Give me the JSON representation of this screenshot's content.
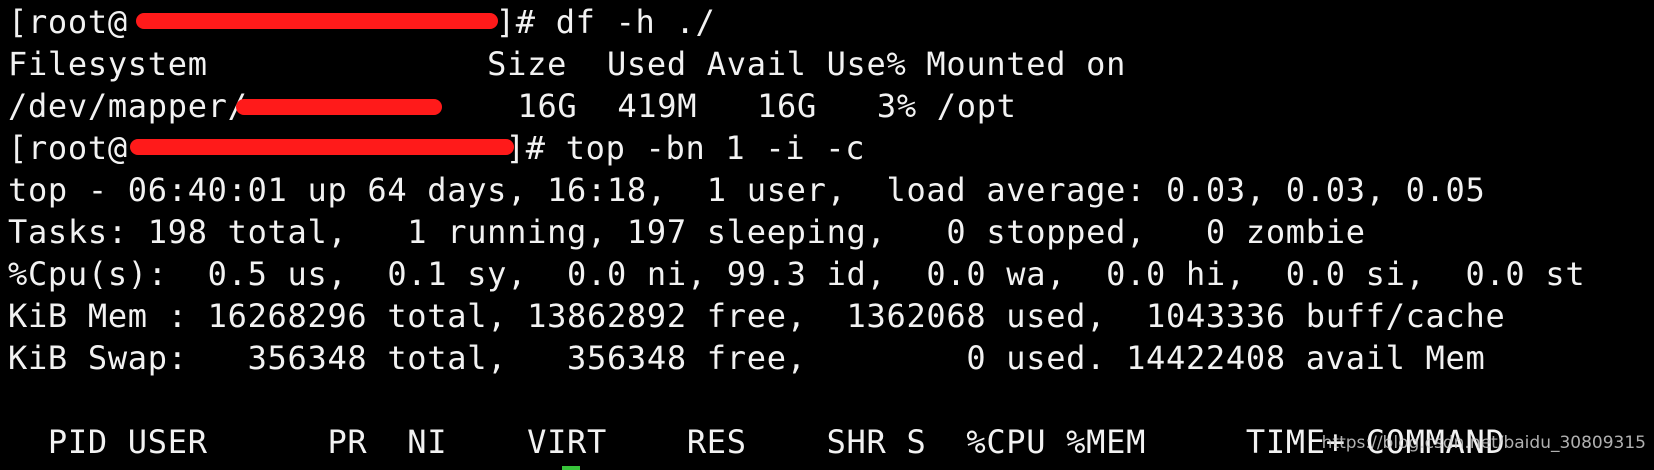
{
  "terminal": {
    "lines": {
      "l0_pre": "[root@",
      "l0_post": "]# df -h ./",
      "l1": "Filesystem              Size  Used Avail Use% Mounted on",
      "l2_pre": "/dev/mapper/",
      "l2_post": "   16G  419M   16G   3% /opt",
      "l3_pre": "[root@",
      "l3_post": "]# top -bn 1 -i -c",
      "l4": "top - 06:40:01 up 64 days, 16:18,  1 user,  load average: 0.03, 0.03, 0.05",
      "l5": "Tasks: 198 total,   1 running, 197 sleeping,   0 stopped,   0 zombie",
      "l6": "%Cpu(s):  0.5 us,  0.1 sy,  0.0 ni, 99.3 id,  0.0 wa,  0.0 hi,  0.0 si,  0.0 st",
      "l7": "KiB Mem : 16268296 total, 13862892 free,  1362068 used,  1043336 buff/cache",
      "l8": "KiB Swap:   356348 total,   356348 free,        0 used. 14422408 avail Mem",
      "l9": "",
      "l10": "  PID USER      PR  NI    VIRT    RES    SHR S  %CPU %MEM     TIME+ COMMAND"
    },
    "redaction_color": "#ff1a1a",
    "background_color": "#000000",
    "text_color": "#f2f2f2"
  },
  "watermark": "https://blog.csdn.net/baidu_30809315"
}
